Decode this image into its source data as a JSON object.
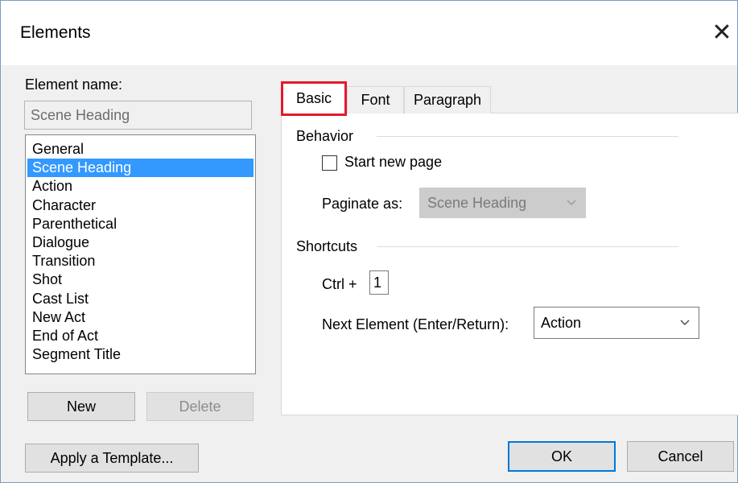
{
  "dialog": {
    "title": "Elements",
    "close_glyph": "✕"
  },
  "left": {
    "element_name_label": "Element name:",
    "element_name_value": "Scene Heading",
    "elements": [
      {
        "label": "General",
        "selected": false
      },
      {
        "label": "Scene Heading",
        "selected": true
      },
      {
        "label": "Action",
        "selected": false
      },
      {
        "label": "Character",
        "selected": false
      },
      {
        "label": "Parenthetical",
        "selected": false
      },
      {
        "label": "Dialogue",
        "selected": false
      },
      {
        "label": "Transition",
        "selected": false
      },
      {
        "label": "Shot",
        "selected": false
      },
      {
        "label": "Cast List",
        "selected": false
      },
      {
        "label": "New Act",
        "selected": false
      },
      {
        "label": "End of Act",
        "selected": false
      },
      {
        "label": "Segment Title",
        "selected": false
      }
    ],
    "new_label": "New",
    "delete_label": "Delete",
    "apply_template_label": "Apply a Template..."
  },
  "tabs": [
    {
      "label": "Basic",
      "active": true
    },
    {
      "label": "Font",
      "active": false
    },
    {
      "label": "Paragraph",
      "active": false
    }
  ],
  "basic": {
    "behavior_label": "Behavior",
    "start_new_page_label": "Start new page",
    "start_new_page_checked": false,
    "paginate_as_label": "Paginate as:",
    "paginate_as_value": "Scene Heading",
    "shortcuts_label": "Shortcuts",
    "ctrl_label": "Ctrl +",
    "ctrl_value": "1",
    "next_element_label": "Next Element (Enter/Return):",
    "next_element_value": "Action"
  },
  "footer": {
    "ok_label": "OK",
    "cancel_label": "Cancel"
  },
  "icons": {
    "close": "close-icon",
    "dropdown": "chevron-down-icon"
  },
  "colors": {
    "selection": "#3399ff",
    "tab_highlight": "#e3192c",
    "default_button_border": "#0078d7"
  }
}
